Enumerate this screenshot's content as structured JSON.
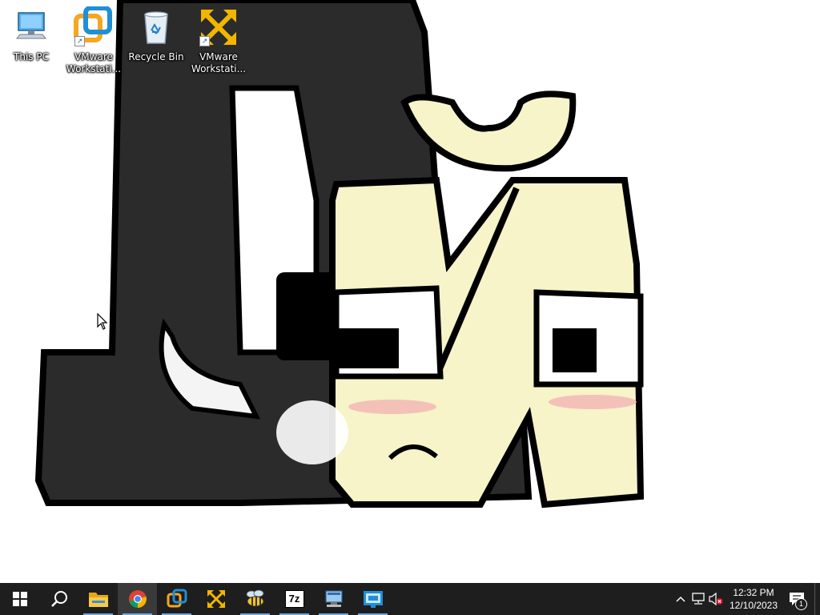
{
  "desktop": {
    "icons": [
      {
        "label": "This PC",
        "icon": "this-pc-icon"
      },
      {
        "label": "VMware Workstati...",
        "icon": "vmware-workstation-icon"
      },
      {
        "label": "Recycle Bin",
        "icon": "recycle-bin-icon"
      },
      {
        "label": "VMware Workstati...",
        "icon": "vmware-workstation-player-icon"
      }
    ]
  },
  "taskbar": {
    "apps": [
      {
        "name": "Start",
        "icon": "windows-logo-icon"
      },
      {
        "name": "Search",
        "icon": "search-icon"
      },
      {
        "name": "File Explorer",
        "icon": "folder-icon"
      },
      {
        "name": "Google Chrome",
        "icon": "chrome-icon"
      },
      {
        "name": "VMware Workstation",
        "icon": "vmware-icon"
      },
      {
        "name": "VMware Workstation Player",
        "icon": "vmware-player-icon"
      },
      {
        "name": "Bee App",
        "icon": "bee-icon"
      },
      {
        "name": "7-Zip",
        "icon": "7zip-icon",
        "text": "7z"
      },
      {
        "name": "Network App",
        "icon": "network-computer-icon"
      },
      {
        "name": "Remote Desktop",
        "icon": "remote-desktop-icon"
      }
    ],
    "tray": {
      "time": "12:32 PM",
      "date": "12/10/2023",
      "notifications_count": "1"
    }
  },
  "colors": {
    "taskbar": "#1e1e1e",
    "accent": "#6fa8dc",
    "vmware_orange": "#f5a623",
    "vmware_blue": "#1f8fd6",
    "vmware_yellow": "#f2b600"
  }
}
